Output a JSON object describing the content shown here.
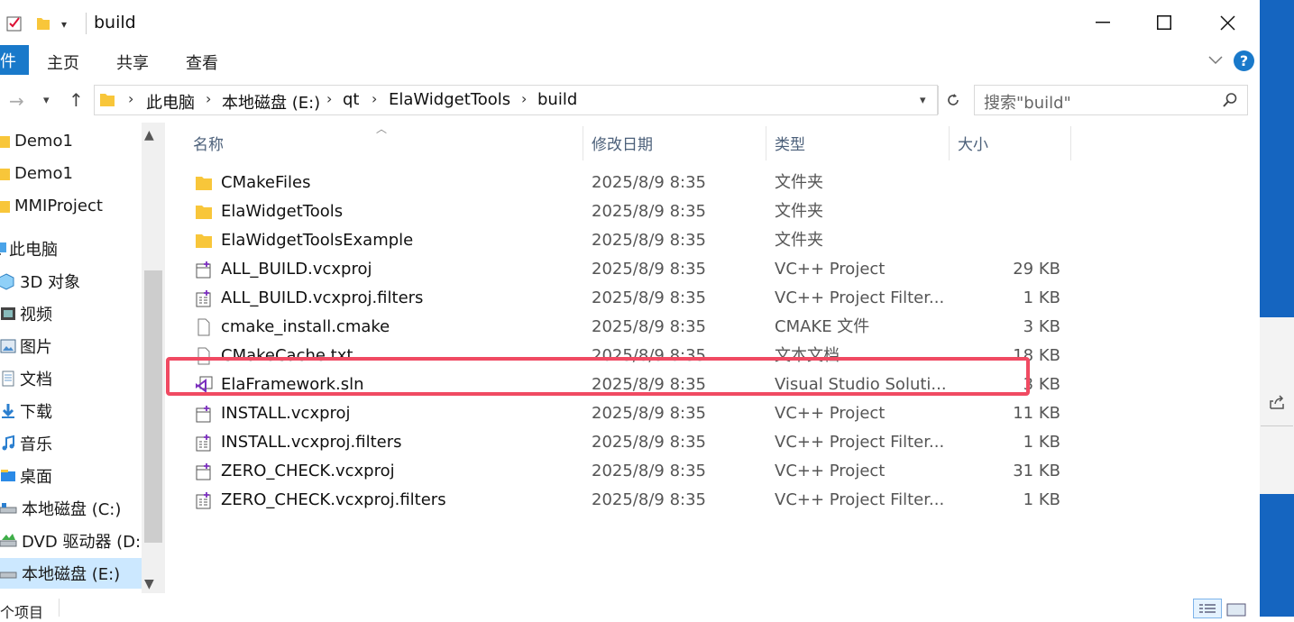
{
  "window": {
    "title": "build",
    "ribbon_tabs": [
      "件",
      "主页",
      "共享",
      "查看"
    ],
    "help": "?"
  },
  "address": {
    "crumbs": [
      "此电脑",
      "本地磁盘 (E:)",
      "qt",
      "ElaWidgetTools",
      "build"
    ],
    "search_placeholder": "搜索\"build\""
  },
  "sidebar": {
    "items": [
      {
        "label": "Demo1",
        "icon": "folder-icon"
      },
      {
        "label": "Demo1",
        "icon": "folder-icon"
      },
      {
        "label": "MMIProject",
        "icon": "folder-icon"
      },
      {
        "label": "此电脑",
        "icon": "computer-icon"
      },
      {
        "label": "3D 对象",
        "icon": "3d-objects-icon"
      },
      {
        "label": "视频",
        "icon": "video-icon"
      },
      {
        "label": "图片",
        "icon": "pictures-icon"
      },
      {
        "label": "文档",
        "icon": "documents-icon"
      },
      {
        "label": "下载",
        "icon": "download-icon"
      },
      {
        "label": "音乐",
        "icon": "music-icon"
      },
      {
        "label": "桌面",
        "icon": "desktop-icon"
      },
      {
        "label": "本地磁盘 (C:)",
        "icon": "drive-icon"
      },
      {
        "label": "DVD 驱动器 (D:)",
        "icon": "dvd-icon"
      },
      {
        "label": "本地磁盘 (E:)",
        "icon": "drive-icon"
      }
    ]
  },
  "columns": {
    "name": "名称",
    "date": "修改日期",
    "type": "类型",
    "size": "大小"
  },
  "files": [
    {
      "name": "CMakeFiles",
      "date": "2025/8/9 8:35",
      "type": "文件夹",
      "size": "",
      "icon": "folder-icon"
    },
    {
      "name": "ElaWidgetTools",
      "date": "2025/8/9 8:35",
      "type": "文件夹",
      "size": "",
      "icon": "folder-icon"
    },
    {
      "name": "ElaWidgetToolsExample",
      "date": "2025/8/9 8:35",
      "type": "文件夹",
      "size": "",
      "icon": "folder-icon"
    },
    {
      "name": "ALL_BUILD.vcxproj",
      "date": "2025/8/9 8:35",
      "type": "VC++ Project",
      "size": "29 KB",
      "icon": "vcxproj-icon"
    },
    {
      "name": "ALL_BUILD.vcxproj.filters",
      "date": "2025/8/9 8:35",
      "type": "VC++ Project Filter...",
      "size": "1 KB",
      "icon": "filters-icon"
    },
    {
      "name": "cmake_install.cmake",
      "date": "2025/8/9 8:35",
      "type": "CMAKE 文件",
      "size": "3 KB",
      "icon": "file-icon"
    },
    {
      "name": "CMakeCache.txt",
      "date": "2025/8/9 8:35",
      "type": "文本文档",
      "size": "18 KB",
      "icon": "file-icon"
    },
    {
      "name": "ElaFramework.sln",
      "date": "2025/8/9 8:35",
      "type": "Visual Studio Soluti...",
      "size": "3 KB",
      "icon": "sln-icon"
    },
    {
      "name": "INSTALL.vcxproj",
      "date": "2025/8/9 8:35",
      "type": "VC++ Project",
      "size": "11 KB",
      "icon": "vcxproj-icon"
    },
    {
      "name": "INSTALL.vcxproj.filters",
      "date": "2025/8/9 8:35",
      "type": "VC++ Project Filter...",
      "size": "1 KB",
      "icon": "filters-icon"
    },
    {
      "name": "ZERO_CHECK.vcxproj",
      "date": "2025/8/9 8:35",
      "type": "VC++ Project",
      "size": "31 KB",
      "icon": "vcxproj-icon"
    },
    {
      "name": "ZERO_CHECK.vcxproj.filters",
      "date": "2025/8/9 8:35",
      "type": "VC++ Project Filter...",
      "size": "1 KB",
      "icon": "filters-icon"
    }
  ],
  "status": {
    "items_text": "个项目"
  },
  "colors": {
    "accent": "#1979ca",
    "highlight": "#f04a62",
    "folder": "#f8c63a"
  }
}
